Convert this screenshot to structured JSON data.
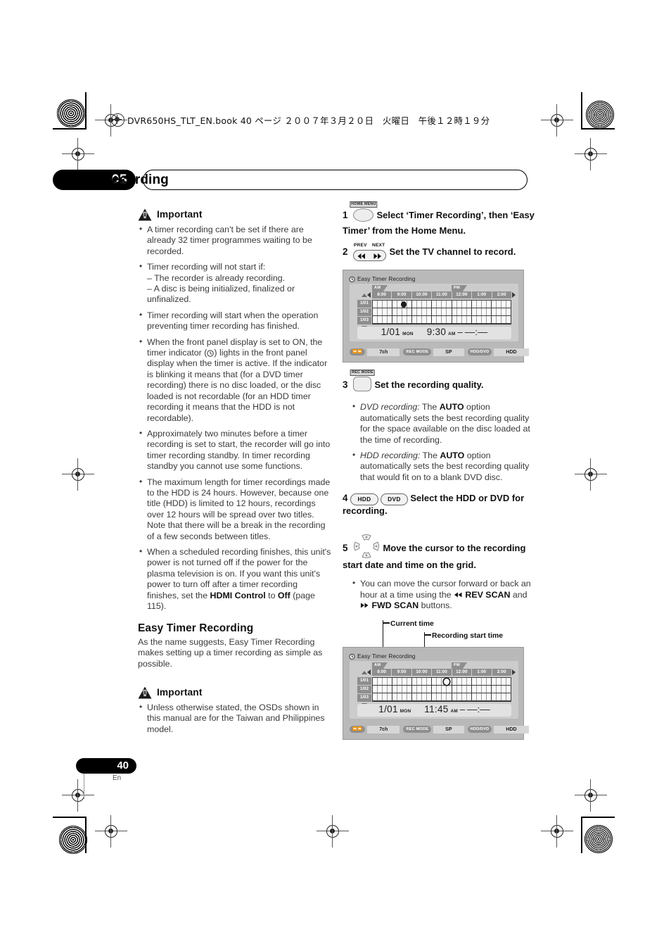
{
  "header": {
    "book_line": "DVR650HS_TLT_EN.book 40 ページ ２００７年３月２０日　火曜日　午後１２時１９分"
  },
  "chapter": {
    "number": "05",
    "title": "Recording"
  },
  "footer": {
    "page_number": "40",
    "language": "En"
  },
  "left_column": {
    "important_1": {
      "label": "Important",
      "bullets": [
        "A timer recording can't be set if there are already 32 timer programmes waiting to be recorded.",
        "Timer recording will not start if:",
        "– The recorder is already recording.",
        "– A disc is being initialized, finalized or unfinalized.",
        "Timer recording will start when the operation preventing timer recording has finished.",
        "When the front panel display is set to ON, the timer indicator ( ) lights in the front panel display when the timer is active. If the indicator is blinking it means that (for a DVD timer recording) there is no disc loaded, or the disc loaded is not recordable (for an HDD timer recording it means that the HDD is not recordable).",
        "Approximately two minutes before a timer recording is set to start, the recorder will go into timer recording standby. In timer recording standby you cannot use some functions.",
        "The maximum length for timer recordings made to the HDD is 24 hours. However, because one title (HDD) is limited to 12 hours, recordings over 12 hours will be spread over two titles. Note that there will be a break in the recording of a few seconds between titles.",
        "When a scheduled recording finishes, this unit's power is not turned off if the power for the plasma television is on. If you want this unit's power to turn off after a timer recording finishes, set the HDMI Control to Off (page 115)."
      ],
      "bullet6_pre": "When the front panel display is set to ON, the timer indicator (",
      "bullet6_post": ") lights in the front panel display when the timer is active. If the indicator is blinking it means that (for a DVD timer recording) there is no disc loaded, or the disc loaded is not recordable (for an HDD timer recording it means that the HDD is not recordable).",
      "bullet9_pre": "When a scheduled recording finishes, this unit's power is not turned off if the power for the plasma television is on. If you want this unit's power to turn off after a timer recording finishes, set the ",
      "bullet9_b1": "HDMI Control",
      "bullet9_mid": " to ",
      "bullet9_b2": "Off",
      "bullet9_post": " (page 115)."
    },
    "section": {
      "heading": "Easy Timer Recording",
      "body": "As the name suggests, Easy Timer Recording makes setting up a timer recording as simple as possible."
    },
    "important_2": {
      "label": "Important",
      "bullets": [
        "Unless otherwise stated, the OSDs shown in this manual are for the Taiwan and Philippines model."
      ]
    }
  },
  "right_column": {
    "steps": [
      {
        "num": "1",
        "button_cap": "HOME MENU",
        "text": "Select ‘Timer Recording’, then ‘Easy Timer’ from the Home Menu."
      },
      {
        "num": "2",
        "button_cap_left": "PREV",
        "button_cap_right": "NEXT",
        "text": "Set the TV channel to record."
      },
      {
        "num": "3",
        "button_cap": "REC MODE",
        "text": "Set the recording quality.",
        "bullets": [
          {
            "italic": "DVD recording:",
            "pre": " The ",
            "bold": "AUTO",
            "post": " option automatically sets the best recording quality for the space available on the disc loaded at the time of recording."
          },
          {
            "italic": "HDD recording:",
            "pre": " The ",
            "bold": "AUTO",
            "post": " option automatically sets the best recording quality that would fit on to a blank DVD disc."
          }
        ]
      },
      {
        "num": "4",
        "button_hdd": "HDD",
        "button_dvd": "DVD",
        "text": "Select the HDD or DVD for recording."
      },
      {
        "num": "5",
        "text": "Move the cursor to the recording start date and time on the grid.",
        "bullet_pre": "You can move the cursor forward or back an hour at a time using the ",
        "bullet_b1": "REV SCAN",
        "bullet_mid": " and ",
        "bullet_b2": "FWD SCAN",
        "bullet_post": " buttons."
      }
    ],
    "callouts": {
      "current_time": "Current time",
      "recording_start_time": "Recording start time"
    }
  },
  "osd_screens": [
    {
      "title": "Easy Timer Recording",
      "am_label": "AM",
      "pm_label": "PM",
      "time_headers": [
        "8:00",
        "9:00",
        "10:00",
        "11:00",
        "12:00",
        "1:00",
        "2:00"
      ],
      "day_rows": [
        "1/01",
        "1/02",
        "1/03"
      ],
      "readout": {
        "date": "1/01",
        "weekday": "MON",
        "time": "9:30",
        "meridiem": "AM",
        "separator": "–",
        "end_time": "––:––"
      },
      "status": {
        "channel_key": "PREV NEXT",
        "channel_value": "7ch",
        "recmode_key": "REC MODE",
        "recmode_value": "SP",
        "device_key": "HDD/DVD",
        "device_value": "HDD"
      },
      "cursor_hollow": false
    },
    {
      "title": "Easy Timer Recording",
      "am_label": "AM",
      "pm_label": "PM",
      "time_headers": [
        "8:00",
        "9:00",
        "10:00",
        "11:00",
        "12:00",
        "1:00",
        "2:00"
      ],
      "day_rows": [
        "1/01",
        "1/02",
        "1/03"
      ],
      "readout": {
        "date": "1/01",
        "weekday": "MON",
        "time": "11:45",
        "meridiem": "AM",
        "separator": "–",
        "end_time": "––:––"
      },
      "status": {
        "channel_key": "PREV NEXT",
        "channel_value": "7ch",
        "recmode_key": "REC MODE",
        "recmode_value": "SP",
        "device_key": "HDD/DVD",
        "device_value": "HDD"
      },
      "cursor_hollow": true
    }
  ],
  "colors": {
    "ink": "#1a1a1a",
    "body_text": "#3a3a3a",
    "osd_bg": "#b9b9b9",
    "osd_panel": "#cccccc",
    "osd_header": "#8e8e8e"
  }
}
